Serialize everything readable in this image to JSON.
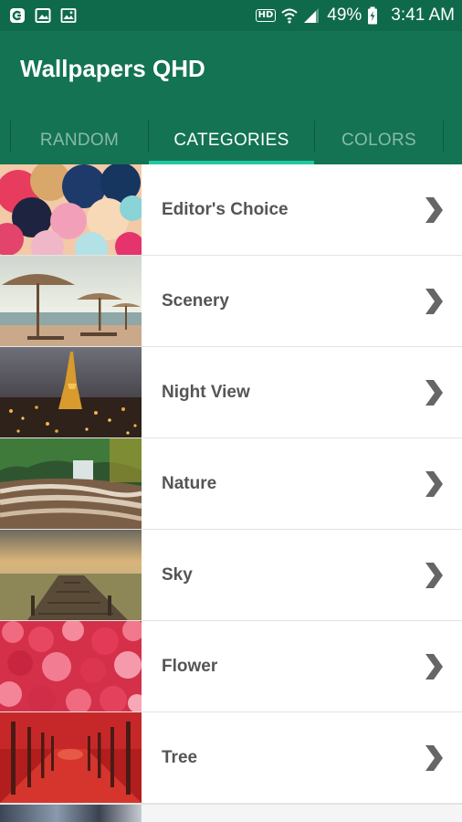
{
  "status_bar": {
    "icons_left": [
      "carrier-icon",
      "image-icon",
      "photo-icon"
    ],
    "hd_label": "HD",
    "battery_percent": "49%",
    "time": "3:41 AM"
  },
  "app_bar": {
    "title": "Wallpapers QHD",
    "background_color": "#137353",
    "accent_color": "#22c7a0"
  },
  "tabs": [
    {
      "label": "RANDOM",
      "active": false
    },
    {
      "label": "CATEGORIES",
      "active": true
    },
    {
      "label": "COLORS",
      "active": false
    }
  ],
  "categories": [
    {
      "label": "Editor's Choice",
      "thumbnail": "balloons"
    },
    {
      "label": "Scenery",
      "thumbnail": "beach-umbrellas"
    },
    {
      "label": "Night View",
      "thumbnail": "city-night"
    },
    {
      "label": "Nature",
      "thumbnail": "waterfall"
    },
    {
      "label": "Sky",
      "thumbnail": "pier-sunset"
    },
    {
      "label": "Flower",
      "thumbnail": "pink-blossoms"
    },
    {
      "label": "Tree",
      "thumbnail": "red-tree-avenue"
    }
  ]
}
